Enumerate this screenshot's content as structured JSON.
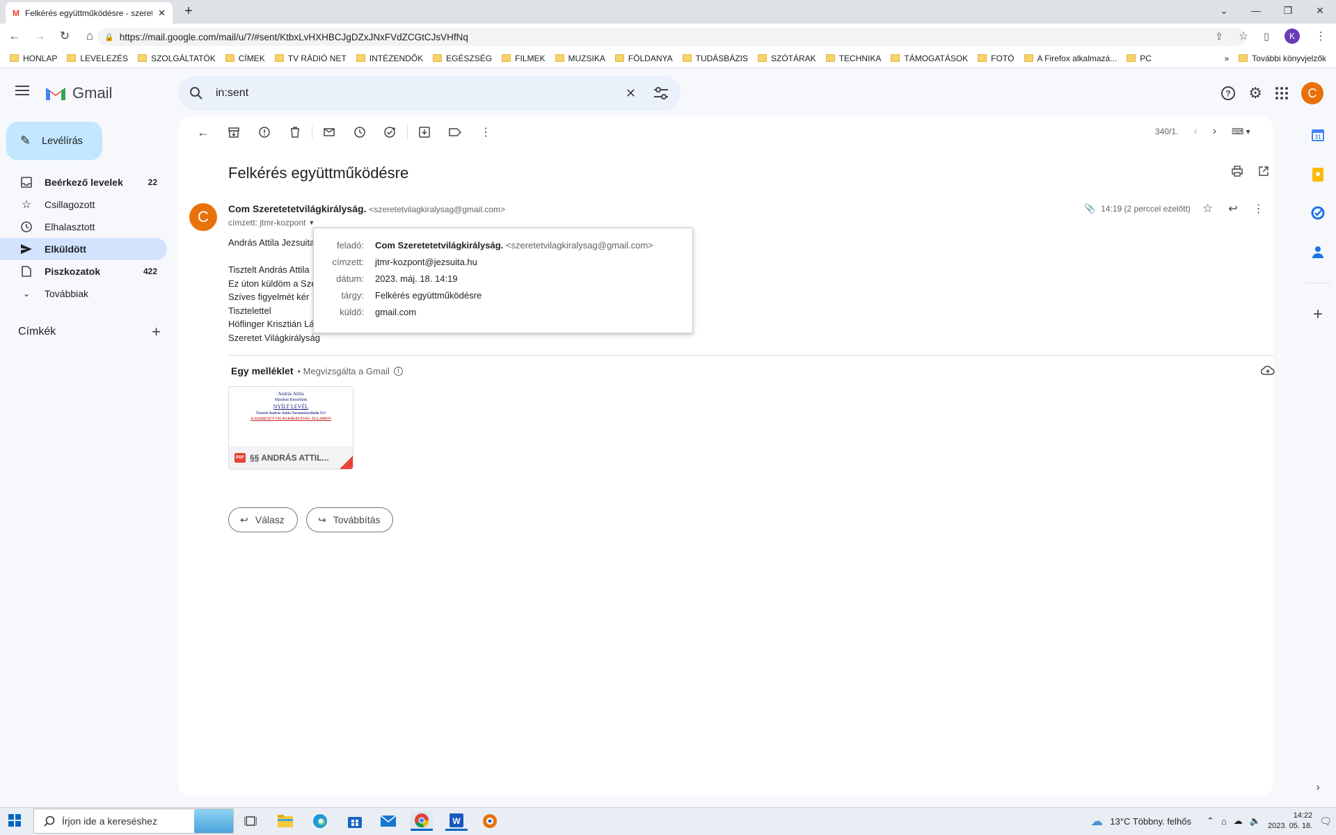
{
  "browser": {
    "tab_title": "Felkérés együttműködésre - szeretetvilagkiralysag@gmail.com",
    "url": "https://mail.google.com/mail/u/7/#sent/KtbxLvHXHBCJgDZxJNxFVdZCGtCJsVHfNq",
    "profile_initial": "K",
    "bookmarks": [
      "HONLAP",
      "LEVELEZÉS",
      "SZOLGÁLTATÓK",
      "CÍMEK",
      "TV RÁDIÓ NET",
      "INTÉZENDŐK",
      "EGÉSZSÉG",
      "FILMEK",
      "MUZSIKA",
      "FÖLDANYA",
      "TUDÁSBÁZIS",
      "SZÓTÁRAK",
      "TECHNIKA",
      "TÁMOGATÁSOK",
      "FOTÓ",
      "A Firefox alkalmazá...",
      "PC"
    ],
    "more_bookmarks": "»",
    "other_bookmarks": "További könyvjelzők"
  },
  "gmail": {
    "logo_text": "Gmail",
    "search_value": "in:sent",
    "avatar_initial": "C",
    "compose_label": "Levélírás",
    "nav": [
      {
        "label": "Beérkező levelek",
        "count": "22"
      },
      {
        "label": "Csillagozott",
        "count": ""
      },
      {
        "label": "Elhalasztott",
        "count": ""
      },
      {
        "label": "Elküldött",
        "count": ""
      },
      {
        "label": "Piszkozatok",
        "count": "422"
      },
      {
        "label": "Továbbiak",
        "count": ""
      }
    ],
    "labels_heading": "Címkék",
    "pager": "340/1.",
    "message": {
      "subject": "Felkérés együttműködésre",
      "sender_name": "Com Szeretetetvilágkirályság.",
      "sender_email": "<szeretetvilagkiralysag@gmail.com>",
      "to_line": "címzett: jtmr-kozpont",
      "time": "14:19 (2 perccel ezelőtt)",
      "body_lines": [
        "András Attila Jezsuita",
        "Tisztelt András Attila",
        "Ez úton küldöm a Sze",
        "Szíves figyelmét kér",
        "Tisztelettel",
        "Höflinger Krisztián Lá",
        "Szeretet Világkirályság"
      ],
      "attachment_label": "Egy melléklet",
      "attachment_scan": "• Megvizsgálta a Gmail",
      "attachment_name": "§§ ANDRÁS ATTIL...",
      "thumb_lines": [
        "András Attila",
        "Mindent Remélünk",
        "NYÍLT LEVÉL",
        "Tisztelt András Attila Tartományfőnök Úr!",
        "A SZERETET VILÁGKIRÁLYSÁG ÁLLAMOT"
      ],
      "reply_label": "Válasz",
      "forward_label": "Továbbítás"
    },
    "details_popup": {
      "from_key": "feladó:",
      "from_name": "Com Szeretetetvilágkirályság.",
      "from_email": "<szeretetvilagkiralysag@gmail.com>",
      "to_key": "címzett:",
      "to_value": "jtmr-kozpont@jezsuita.hu",
      "date_key": "dátum:",
      "date_value": "2023. máj. 18. 14:19",
      "subject_key": "tárgy:",
      "subject_value": "Felkérés együttműködésre",
      "sender_key": "küldő:",
      "sender_value": "gmail.com"
    }
  },
  "taskbar": {
    "search_placeholder": "Írjon ide a kereséshez",
    "weather": "13°C  Többny. felhős",
    "time": "14:22",
    "date": "2023. 05. 18."
  },
  "colors": {
    "accent": "#0b57d0",
    "avatar": "#e8710a",
    "selected_nav": "#d3e3fd",
    "compose": "#c2e7ff"
  }
}
